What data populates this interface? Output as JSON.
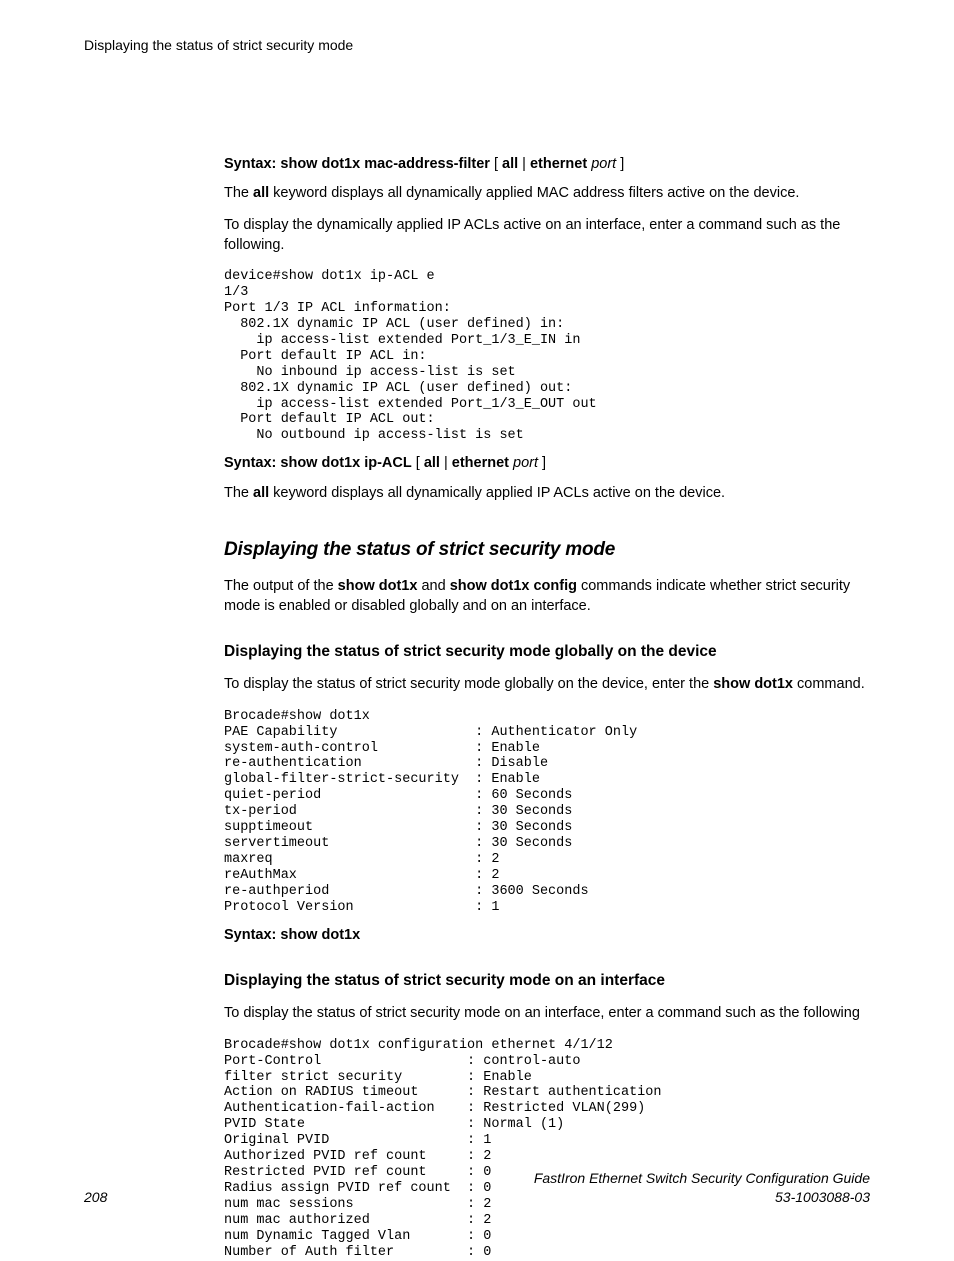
{
  "header": {
    "running_title": "Displaying the status of strict security mode"
  },
  "syntax1": {
    "prefix": "Syntax: show dot1x mac-address-filter",
    "lb": "[",
    "all": "all",
    "pipe": " | ",
    "eth": "ethernet",
    "port": "port",
    "rb": "]"
  },
  "para1": {
    "t1": "The ",
    "b1": "all",
    "t2": " keyword displays all dynamically applied MAC address filters active on the device."
  },
  "para2": "To display the dynamically applied IP ACLs active on an interface, enter a command such as the following.",
  "code1": "device#show dot1x ip-ACL e\n1/3\nPort 1/3 IP ACL information:\n  802.1X dynamic IP ACL (user defined) in:\n    ip access-list extended Port_1/3_E_IN in\n  Port default IP ACL in:\n    No inbound ip access-list is set\n  802.1X dynamic IP ACL (user defined) out:\n    ip access-list extended Port_1/3_E_OUT out\n  Port default IP ACL out:\n    No outbound ip access-list is set",
  "syntax2": {
    "prefix": "Syntax: show dot1x ip-ACL",
    "lb": "[",
    "all": "all",
    "pipe": " | ",
    "eth": "ethernet",
    "port": "port",
    "rb": "]"
  },
  "para3": {
    "t1": "The ",
    "b1": "all",
    "t2": " keyword displays all dynamically applied IP ACLs active on the device."
  },
  "h2": "Displaying the status of strict security mode",
  "para4": {
    "t1": "The output of the ",
    "b1": "show dot1x",
    "t2": " and ",
    "b2": "show dot1x config",
    "t3": " commands indicate whether strict security mode is enabled or disabled globally and on an interface."
  },
  "h3a": "Displaying the status of strict security mode globally on the device",
  "para5": {
    "t1": "To display the status of strict security mode globally on the device, enter the ",
    "b1": "show dot1x",
    "t2": " command."
  },
  "code2": "Brocade#show dot1x\nPAE Capability                 : Authenticator Only\nsystem-auth-control            : Enable\nre-authentication              : Disable\nglobal-filter-strict-security  : Enable\nquiet-period                   : 60 Seconds\ntx-period                      : 30 Seconds\nsupptimeout                    : 30 Seconds\nservertimeout                  : 30 Seconds\nmaxreq                         : 2\nreAuthMax                      : 2\nre-authperiod                  : 3600 Seconds\nProtocol Version               : 1",
  "syntax3": "Syntax: show dot1x",
  "h3b": "Displaying the status of strict security mode on an interface",
  "para6": "To display the status of strict security mode on an interface, enter a command such as the following",
  "code3": "Brocade#show dot1x configuration ethernet 4/1/12\nPort-Control                  : control-auto\nfilter strict security        : Enable\nAction on RADIUS timeout      : Restart authentication\nAuthentication-fail-action    : Restricted VLAN(299)\nPVID State                    : Normal (1)\nOriginal PVID                 : 1\nAuthorized PVID ref count     : 2\nRestricted PVID ref count     : 0\nRadius assign PVID ref count  : 0\nnum mac sessions              : 2\nnum mac authorized            : 2\nnum Dynamic Tagged Vlan       : 0\nNumber of Auth filter         : 0",
  "footer": {
    "page": "208",
    "title": "FastIron Ethernet Switch Security Configuration Guide",
    "docid": "53-1003088-03"
  }
}
